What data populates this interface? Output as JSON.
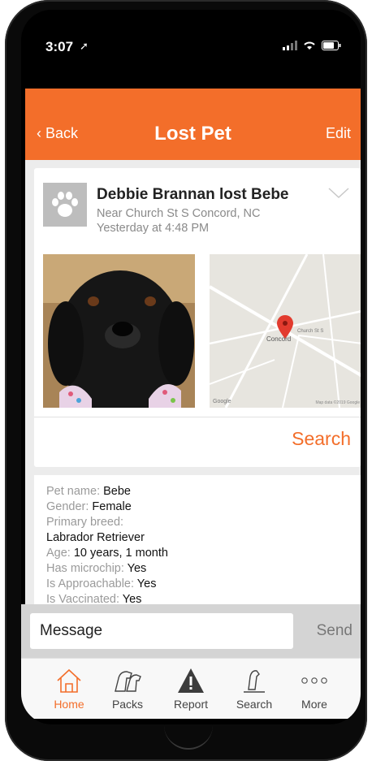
{
  "status_bar": {
    "time": "3:07"
  },
  "nav": {
    "back_label": "Back",
    "title": "Lost Pet",
    "edit_label": "Edit"
  },
  "post": {
    "title": "Debbie Brannan lost Bebe",
    "location": "Near Church St S Concord, NC",
    "time": "Yesterday at 4:48 PM",
    "map_label": "Concord",
    "map_street": "Church St S",
    "map_google": "Google",
    "map_copyright": "Map data ©2019 Google",
    "search_label": "Search"
  },
  "details": [
    {
      "label": "Pet name: ",
      "value": "Bebe"
    },
    {
      "label": "Gender: ",
      "value": "Female"
    },
    {
      "label": "Primary breed:",
      "value": ""
    },
    {
      "label": "",
      "value": "Labrador Retriever"
    },
    {
      "label": "Age: ",
      "value": "10 years, 1 month"
    },
    {
      "label": "Has microchip: ",
      "value": "Yes"
    },
    {
      "label": "Is Approachable: ",
      "value": "Yes"
    },
    {
      "label": "Is Vaccinated: ",
      "value": "Yes"
    }
  ],
  "message": {
    "placeholder": "Message",
    "send_label": "Send"
  },
  "tabs": [
    {
      "label": "Home",
      "icon": "house-icon",
      "active": true
    },
    {
      "label": "Packs",
      "icon": "dogs-icon",
      "active": false
    },
    {
      "label": "Report",
      "icon": "warning-icon",
      "active": false
    },
    {
      "label": "Search",
      "icon": "search-dog-icon",
      "active": false
    },
    {
      "label": "More",
      "icon": "ellipsis-icon",
      "active": false
    }
  ],
  "colors": {
    "accent": "#f36e2a",
    "nav_text": "#ffffff",
    "muted": "#8a8a8a"
  }
}
